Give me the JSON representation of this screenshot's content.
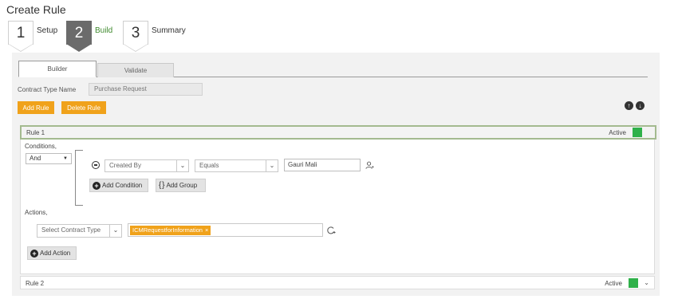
{
  "page": {
    "title": "Create Rule"
  },
  "steps": [
    {
      "number": "1",
      "label": "Setup"
    },
    {
      "number": "2",
      "label": "Build",
      "active": true
    },
    {
      "number": "3",
      "label": "Summary"
    }
  ],
  "tabs": {
    "builder": "Builder",
    "validate": "Validate"
  },
  "contract_type": {
    "label": "Contract Type Name",
    "value": "Purchase Request"
  },
  "toolbar": {
    "add_rule": "Add Rule",
    "delete_rule": "Delete Rule",
    "up_icon": "arrow-up-circle-icon",
    "down_icon": "arrow-down-circle-icon"
  },
  "rule1": {
    "title": "Rule 1",
    "status": "Active",
    "status_color": "#2fb14a",
    "conditions_label": "Conditions,",
    "logic_select": "And",
    "condition": {
      "field": "Created By",
      "operator": "Equals",
      "value": "Gauri Mali"
    },
    "add_condition": "Add Condition",
    "add_group": "Add Group",
    "actions_label": "Actions,",
    "action_select_placeholder": "Select Contract Type",
    "action_tag": "ICMRequestforInformation",
    "add_action": "Add Action"
  },
  "rule2": {
    "title": "Rule 2",
    "status": "Active",
    "status_color": "#2fb14a"
  },
  "colors": {
    "accent": "#f0a21b",
    "active_step": "#6b6b6b",
    "active_label": "#3f8a2e"
  }
}
